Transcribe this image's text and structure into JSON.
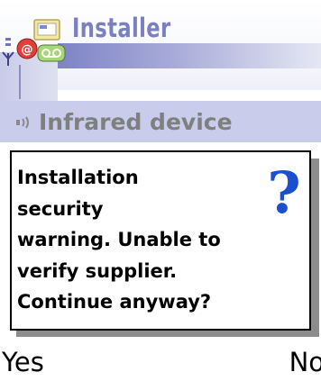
{
  "app": {
    "title": "Installer",
    "icon": "installer-app-icon"
  },
  "status": {
    "signal_icon": "antenna-icon"
  },
  "navigation": {
    "icon": "infrared-icon",
    "label": "Infrared device"
  },
  "dialog": {
    "icon": "question-mark-icon",
    "lines": [
      "Installation",
      "security",
      "warning. Unable to",
      "verify supplier.",
      "Continue anyway?"
    ]
  },
  "softkeys": {
    "left_label": "Yes",
    "right_label": "No"
  },
  "colors": {
    "title_text": "#7a7fc0",
    "title_bar": "#7e83c6",
    "navigation_pane": "#c9ccea",
    "query_icon": "#1a4fd0"
  }
}
